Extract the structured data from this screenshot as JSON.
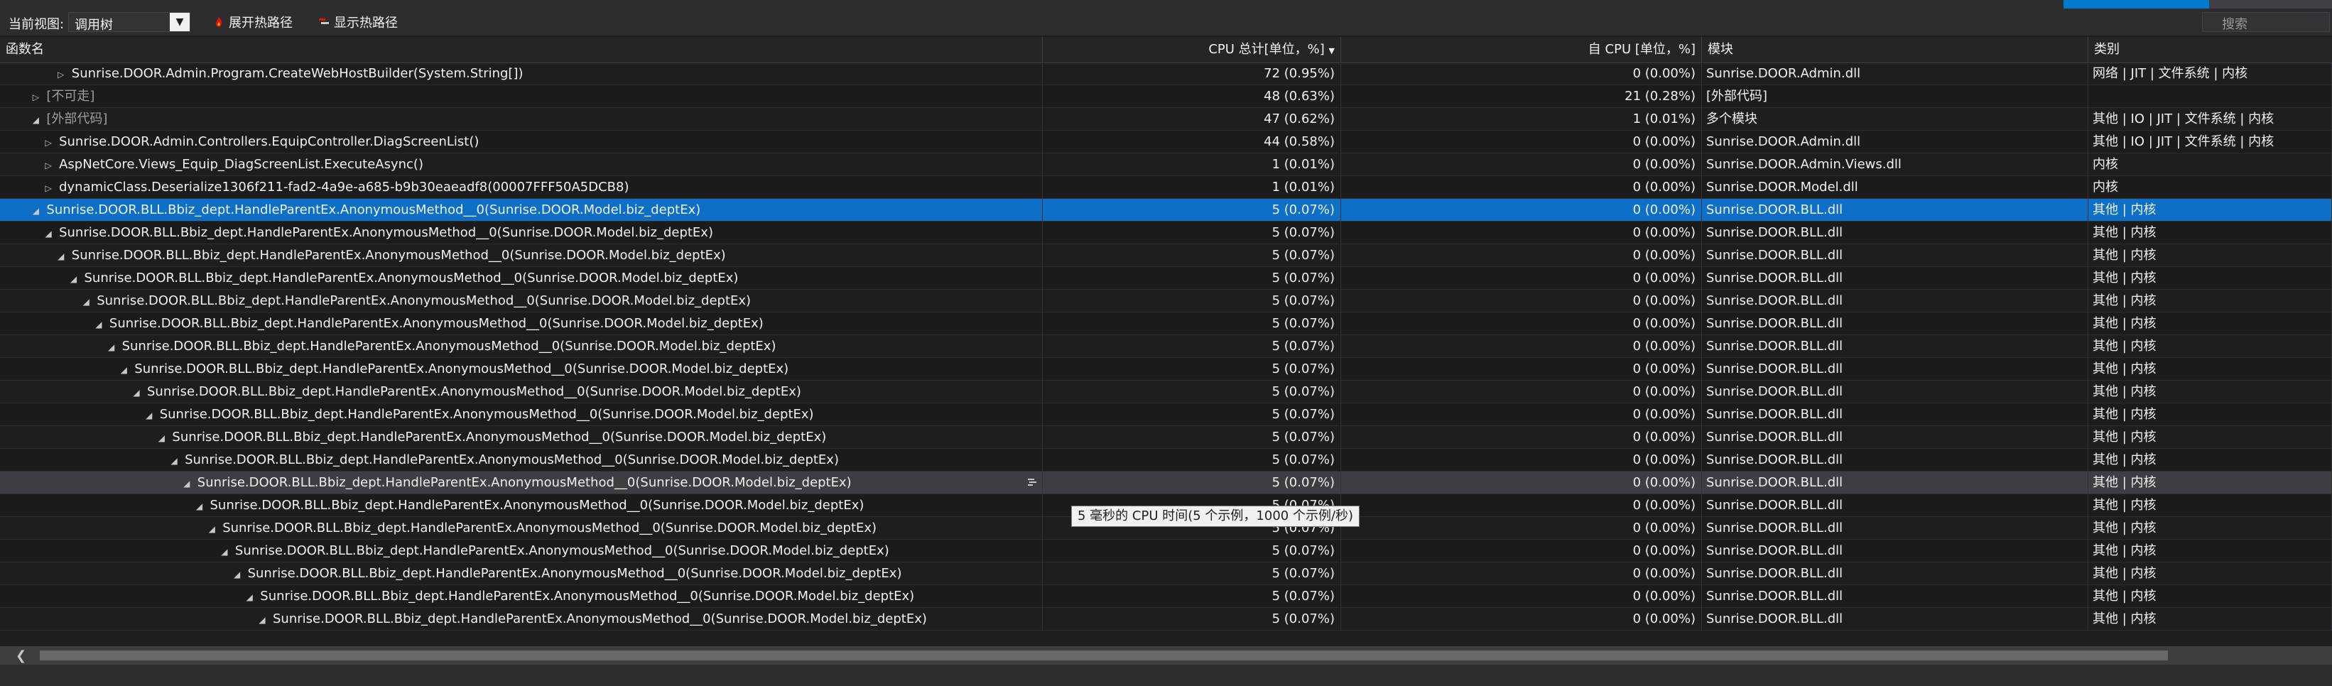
{
  "toolbar": {
    "view_label": "当前视图:",
    "view_value": "调用树",
    "expand_hot_path": "展开热路径",
    "show_hot_path": "显示热路径",
    "search_placeholder": "搜索"
  },
  "table": {
    "columns": {
      "name": "函数名",
      "cpu_total": "CPU 总计[单位，%]",
      "self_cpu": "自 CPU [单位，%]",
      "module": "模块",
      "category": "类别"
    },
    "rows": [
      {
        "indent": 4,
        "expander": "collapsed",
        "name": "Sunrise.DOOR.Admin.Program.CreateWebHostBuilder(System.String[])",
        "total": "72 (0.95%)",
        "self": "0 (0.00%)",
        "module": "Sunrise.DOOR.Admin.dll",
        "category": "网络 | JIT | 文件系统 | 内核"
      },
      {
        "indent": 2,
        "expander": "collapsed",
        "name": "[不可走]",
        "total": "48 (0.63%)",
        "self": "21 (0.28%)",
        "module": "[外部代码]",
        "category": "",
        "dim": true
      },
      {
        "indent": 2,
        "expander": "expanded",
        "name": "[外部代码]",
        "total": "47 (0.62%)",
        "self": "1 (0.01%)",
        "module": "多个模块",
        "category": "其他 | IO | JIT | 文件系统 | 内核",
        "dim": true
      },
      {
        "indent": 3,
        "expander": "collapsed",
        "name": "Sunrise.DOOR.Admin.Controllers.EquipController.DiagScreenList()",
        "total": "44 (0.58%)",
        "self": "0 (0.00%)",
        "module": "Sunrise.DOOR.Admin.dll",
        "category": "其他 | IO | JIT | 文件系统 | 内核"
      },
      {
        "indent": 3,
        "expander": "collapsed",
        "name": "AspNetCore.Views_Equip_DiagScreenList.ExecuteAsync()",
        "total": "1 (0.01%)",
        "self": "0 (0.00%)",
        "module": "Sunrise.DOOR.Admin.Views.dll",
        "category": "内核"
      },
      {
        "indent": 3,
        "expander": "collapsed",
        "name": "dynamicClass.Deserialize1306f211-fad2-4a9e-a685-b9b30eaeadf8(00007FFF50A5DCB8)",
        "total": "1 (0.01%)",
        "self": "0 (0.00%)",
        "module": "Sunrise.DOOR.Model.dll",
        "category": "内核"
      },
      {
        "indent": 2,
        "expander": "expanded",
        "name": "Sunrise.DOOR.BLL.Bbiz_dept.HandleParentEx.AnonymousMethod__0(Sunrise.DOOR.Model.biz_deptEx)",
        "total": "5 (0.07%)",
        "self": "0 (0.00%)",
        "module": "Sunrise.DOOR.BLL.dll",
        "category": "其他 | 内核",
        "selected": true
      },
      {
        "indent": 3,
        "expander": "expanded",
        "name": "Sunrise.DOOR.BLL.Bbiz_dept.HandleParentEx.AnonymousMethod__0(Sunrise.DOOR.Model.biz_deptEx)",
        "total": "5 (0.07%)",
        "self": "0 (0.00%)",
        "module": "Sunrise.DOOR.BLL.dll",
        "category": "其他 | 内核"
      },
      {
        "indent": 4,
        "expander": "expanded",
        "name": "Sunrise.DOOR.BLL.Bbiz_dept.HandleParentEx.AnonymousMethod__0(Sunrise.DOOR.Model.biz_deptEx)",
        "total": "5 (0.07%)",
        "self": "0 (0.00%)",
        "module": "Sunrise.DOOR.BLL.dll",
        "category": "其他 | 内核"
      },
      {
        "indent": 5,
        "expander": "expanded",
        "name": "Sunrise.DOOR.BLL.Bbiz_dept.HandleParentEx.AnonymousMethod__0(Sunrise.DOOR.Model.biz_deptEx)",
        "total": "5 (0.07%)",
        "self": "0 (0.00%)",
        "module": "Sunrise.DOOR.BLL.dll",
        "category": "其他 | 内核"
      },
      {
        "indent": 6,
        "expander": "expanded",
        "name": "Sunrise.DOOR.BLL.Bbiz_dept.HandleParentEx.AnonymousMethod__0(Sunrise.DOOR.Model.biz_deptEx)",
        "total": "5 (0.07%)",
        "self": "0 (0.00%)",
        "module": "Sunrise.DOOR.BLL.dll",
        "category": "其他 | 内核"
      },
      {
        "indent": 7,
        "expander": "expanded",
        "name": "Sunrise.DOOR.BLL.Bbiz_dept.HandleParentEx.AnonymousMethod__0(Sunrise.DOOR.Model.biz_deptEx)",
        "total": "5 (0.07%)",
        "self": "0 (0.00%)",
        "module": "Sunrise.DOOR.BLL.dll",
        "category": "其他 | 内核"
      },
      {
        "indent": 8,
        "expander": "expanded",
        "name": "Sunrise.DOOR.BLL.Bbiz_dept.HandleParentEx.AnonymousMethod__0(Sunrise.DOOR.Model.biz_deptEx)",
        "total": "5 (0.07%)",
        "self": "0 (0.00%)",
        "module": "Sunrise.DOOR.BLL.dll",
        "category": "其他 | 内核"
      },
      {
        "indent": 9,
        "expander": "expanded",
        "name": "Sunrise.DOOR.BLL.Bbiz_dept.HandleParentEx.AnonymousMethod__0(Sunrise.DOOR.Model.biz_deptEx)",
        "total": "5 (0.07%)",
        "self": "0 (0.00%)",
        "module": "Sunrise.DOOR.BLL.dll",
        "category": "其他 | 内核"
      },
      {
        "indent": 10,
        "expander": "expanded",
        "name": "Sunrise.DOOR.BLL.Bbiz_dept.HandleParentEx.AnonymousMethod__0(Sunrise.DOOR.Model.biz_deptEx)",
        "total": "5 (0.07%)",
        "self": "0 (0.00%)",
        "module": "Sunrise.DOOR.BLL.dll",
        "category": "其他 | 内核"
      },
      {
        "indent": 11,
        "expander": "expanded",
        "name": "Sunrise.DOOR.BLL.Bbiz_dept.HandleParentEx.AnonymousMethod__0(Sunrise.DOOR.Model.biz_deptEx)",
        "total": "5 (0.07%)",
        "self": "0 (0.00%)",
        "module": "Sunrise.DOOR.BLL.dll",
        "category": "其他 | 内核"
      },
      {
        "indent": 12,
        "expander": "expanded",
        "name": "Sunrise.DOOR.BLL.Bbiz_dept.HandleParentEx.AnonymousMethod__0(Sunrise.DOOR.Model.biz_deptEx)",
        "total": "5 (0.07%)",
        "self": "0 (0.00%)",
        "module": "Sunrise.DOOR.BLL.dll",
        "category": "其他 | 内核"
      },
      {
        "indent": 13,
        "expander": "expanded",
        "name": "Sunrise.DOOR.BLL.Bbiz_dept.HandleParentEx.AnonymousMethod__0(Sunrise.DOOR.Model.biz_deptEx)",
        "total": "5 (0.07%)",
        "self": "0 (0.00%)",
        "module": "Sunrise.DOOR.BLL.dll",
        "category": "其他 | 内核"
      },
      {
        "indent": 14,
        "expander": "expanded",
        "name": "Sunrise.DOOR.BLL.Bbiz_dept.HandleParentEx.AnonymousMethod__0(Sunrise.DOOR.Model.biz_deptEx)",
        "total": "5 (0.07%)",
        "self": "0 (0.00%)",
        "module": "Sunrise.DOOR.BLL.dll",
        "category": "其他 | 内核",
        "hover": true
      },
      {
        "indent": 15,
        "expander": "expanded",
        "name": "Sunrise.DOOR.BLL.Bbiz_dept.HandleParentEx.AnonymousMethod__0(Sunrise.DOOR.Model.biz_deptEx)",
        "total": "5 (0.07%)",
        "self": "0 (0.00%)",
        "module": "Sunrise.DOOR.BLL.dll",
        "category": "其他 | 内核"
      },
      {
        "indent": 16,
        "expander": "expanded",
        "name": "Sunrise.DOOR.BLL.Bbiz_dept.HandleParentEx.AnonymousMethod__0(Sunrise.DOOR.Model.biz_deptEx)",
        "total": "5 (0.07%)",
        "self": "0 (0.00%)",
        "module": "Sunrise.DOOR.BLL.dll",
        "category": "其他 | 内核"
      },
      {
        "indent": 17,
        "expander": "expanded",
        "name": "Sunrise.DOOR.BLL.Bbiz_dept.HandleParentEx.AnonymousMethod__0(Sunrise.DOOR.Model.biz_deptEx)",
        "total": "5 (0.07%)",
        "self": "0 (0.00%)",
        "module": "Sunrise.DOOR.BLL.dll",
        "category": "其他 | 内核"
      },
      {
        "indent": 18,
        "expander": "expanded",
        "name": "Sunrise.DOOR.BLL.Bbiz_dept.HandleParentEx.AnonymousMethod__0(Sunrise.DOOR.Model.biz_deptEx)",
        "total": "5 (0.07%)",
        "self": "0 (0.00%)",
        "module": "Sunrise.DOOR.BLL.dll",
        "category": "其他 | 内核"
      },
      {
        "indent": 19,
        "expander": "expanded",
        "name": "Sunrise.DOOR.BLL.Bbiz_dept.HandleParentEx.AnonymousMethod__0(Sunrise.DOOR.Model.biz_deptEx)",
        "total": "5 (0.07%)",
        "self": "0 (0.00%)",
        "module": "Sunrise.DOOR.BLL.dll",
        "category": "其他 | 内核"
      },
      {
        "indent": 20,
        "expander": "expanded",
        "name": "Sunrise.DOOR.BLL.Bbiz_dept.HandleParentEx.AnonymousMethod__0(Sunrise.DOOR.Model.biz_deptEx)",
        "total": "5 (0.07%)",
        "self": "0 (0.00%)",
        "module": "Sunrise.DOOR.BLL.dll",
        "category": "其他 | 内核"
      }
    ]
  },
  "tooltip": "5 毫秒的 CPU 时间(5 个示例，1000 个示例/秒)",
  "colors": {
    "background": "#1e1e1e",
    "selection": "#0e6fc7",
    "accent": "#007acc"
  }
}
